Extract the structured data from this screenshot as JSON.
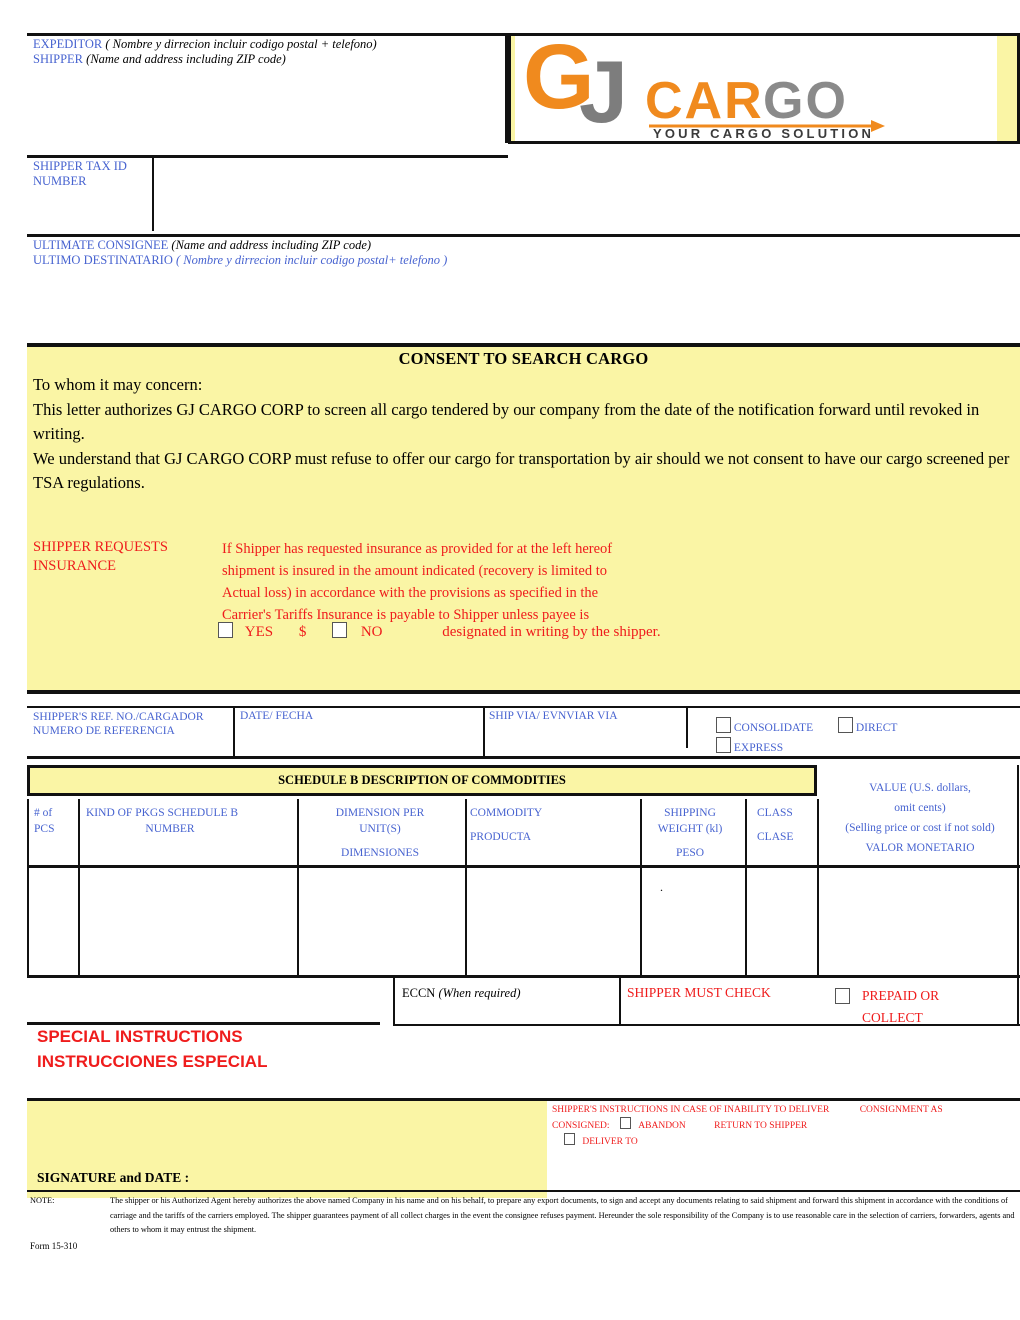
{
  "colors": {
    "blue": "#4763d0",
    "red": "#ef1c1c",
    "yellow": "#faf5a5",
    "black": "#111111",
    "logo_orange": "#f08a1e",
    "logo_gray": "#7d7d7d"
  },
  "shipper": {
    "line1_label": "EXPEDITOR",
    "line1_note": "( Nombre y dirrecion incluir codigo postal + telefono)",
    "line2_label": "SHIPPER",
    "line2_note": "(Name and address including ZIP code)"
  },
  "logo": {
    "mark_g": "G",
    "mark_j": "J",
    "wordmark_car": "CAR",
    "wordmark_go": "GO",
    "tagline": "YOUR CARGO SOLUTION"
  },
  "tax_id": {
    "line1": "SHIPPER TAX ID",
    "line2": "NUMBER"
  },
  "consignee": {
    "line1_label": "ULTIMATE CONSIGNEE",
    "line1_note": "(Name and address including ZIP code)",
    "line2_label": "ULTIMO DESTINATARIO",
    "line2_note": "( Nombre y dirrecion incluir codigo postal+  telefono  )"
  },
  "consent": {
    "title": "CONSENT TO  SEARCH CARGO",
    "p1": "To whom it may concern:",
    "p2": "This letter authorizes GJ CARGO CORP to screen all cargo tendered by our company from the date of the notification forward until revoked in writing.",
    "p3": "We understand that GJ CARGO CORP must refuse to offer our cargo for transportation by air should we not consent  to have our cargo screened per TSA regulations."
  },
  "insurance": {
    "label_line1": "SHIPPER REQUESTS",
    "label_line2": "INSURANCE",
    "body_line1": "If Shipper has requested insurance as provided for at the left hereof",
    "body_line2": "shipment  is insured in the amount  indicated (recovery is limited to",
    "body_line3": "Actual loss)  in  accordance  with the provisions  as specified in  the",
    "body_line4": "Carrier's Tariffs  Insurance  is payable  to Shipper  unless  payee  is",
    "yes": "YES",
    "dollar": "$",
    "no": "NO",
    "tail": "designated in writing by the shipper."
  },
  "reference": {
    "ref_line1": "SHIPPER'S REF. NO./CARGADOR",
    "ref_line2": "NUMERO DE REFERENCIA",
    "date": "DATE/ FECHA",
    "ship_via": "SHIP VIA/ EVNVIAR VIA",
    "opt_consolidate": "CONSOLIDATE",
    "opt_direct": "DIRECT",
    "opt_express": "EXPRESS"
  },
  "schedule_b": {
    "banner": "SCHEDULE B DESCRIPTION OF COMMODITIES",
    "value_l1": "VALUE (U.S. dollars,",
    "value_l2": "omit cents)",
    "value_l3": "(Selling price or cost if  not sold)",
    "value_l4": "VALOR MONETARIO",
    "columns": [
      {
        "l1": "# of",
        "l2": "PCS",
        "l3": "",
        "l4": ""
      },
      {
        "l1": "KIND OF  PKGS SCHEDULE B",
        "l2": "NUMBER",
        "l3": "",
        "l4": ""
      },
      {
        "l1": "DIMENSION PER",
        "l2": "UNIT(S)",
        "l3": "",
        "l4": "DIMENSIONES"
      },
      {
        "l1": "COMMODITY",
        "l2": "",
        "l3": "PRODUCTA",
        "l4": ""
      },
      {
        "l1": "SHIPPING",
        "l2": "WEIGHT (kl)",
        "l3": "",
        "l4": "PESO"
      },
      {
        "l1": "CLASS",
        "l2": "",
        "l3": "CLASE",
        "l4": ""
      }
    ],
    "rows": [
      {
        "pcs": "",
        "kind": "",
        "dimension": "",
        "commodity": "",
        "weight": ".",
        "class": "",
        "value": ""
      }
    ]
  },
  "eccn": {
    "label": "ECCN",
    "note": "(When required)",
    "shipper_must_check": "SHIPPER MUST CHECK",
    "prepaid_l1": "PREPAID OR",
    "prepaid_l2": "COLLECT"
  },
  "special_instructions": {
    "line1": "SPECIAL INSTRUCTIONS",
    "line2": "INSTRUCCIONES ESPECIAL"
  },
  "delivery_instructions": {
    "l1a": "SHIPPER'S INSTRUCTIONS IN CASE OF INABILITY TO DELIVER",
    "l1b": "CONSIGNMENT AS",
    "l2a": "CONSIGNED:",
    "l2b": "ABANDON",
    "l2c": "RETURN TO SHIPPER",
    "l3": "DELIVER TO"
  },
  "signature": {
    "label": "SIGNATURE and DATE :"
  },
  "note": {
    "label": "NOTE:",
    "body": "The shipper or his Authorized Agent hereby authorizes the above named Company in his name and on his behalf, to prepare any export documents, to sign and accept any documents relating to said shipment and forward this shipment in accordance with the conditions of carriage and the tariffs of the carriers employed.  The shipper guarantees payment of all collect charges in the event the consignee refuses payment. Hereunder the sole responsibility of the Company is to use reasonable care in the selection of carriers, forwarders, agents and others to whom it may entrust the shipment."
  },
  "form_number": "Form 15-310"
}
